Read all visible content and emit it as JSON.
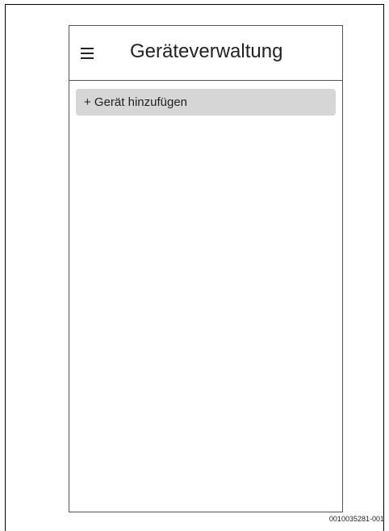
{
  "header": {
    "title": "Geräteverwaltung",
    "menu_icon": "hamburger-menu-icon"
  },
  "main": {
    "add_device_label": "+ Gerät hinzufügen"
  },
  "figure": {
    "code": "0010035281-001"
  },
  "colors": {
    "button_background": "#d6d6d6",
    "border": "#555555",
    "text": "#222222"
  }
}
